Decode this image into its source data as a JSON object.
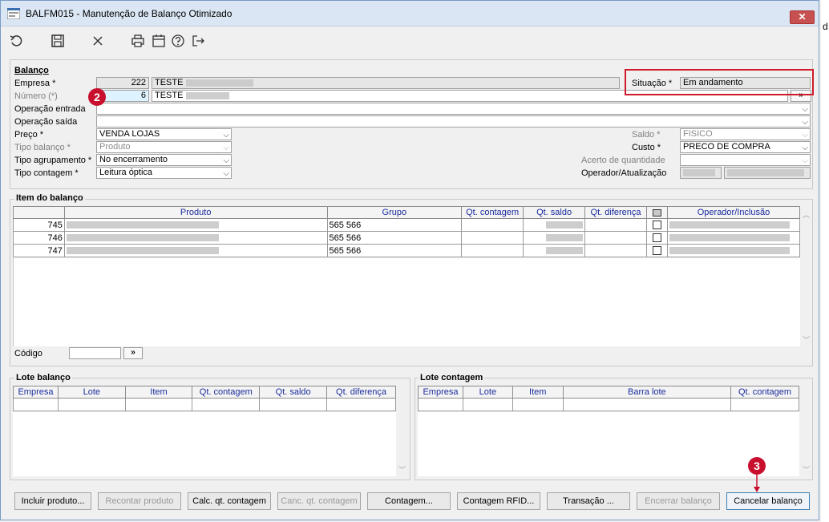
{
  "window": {
    "title": "BALFM015 - Manutenção de Balanço Otimizado",
    "close_label": "✕"
  },
  "edge_text": "d",
  "toolbar": {
    "buttons": [
      {
        "icon": "undo-icon"
      },
      {
        "icon": "save-icon"
      },
      {
        "icon": "close-icon"
      },
      {
        "icon": "print-icon"
      },
      {
        "icon": "calendar-icon"
      },
      {
        "icon": "help-icon"
      },
      {
        "icon": "exit-icon"
      }
    ]
  },
  "balanco": {
    "section_title": "Balanço",
    "empresa": {
      "label": "Empresa *",
      "code": "222",
      "name": "TESTE"
    },
    "numero": {
      "label": "Número (*)",
      "value": "6",
      "name": "TESTE",
      "button": "»"
    },
    "operacao_entrada": {
      "label": "Operação entrada",
      "value": ""
    },
    "operacao_saida": {
      "label": "Operação saída",
      "value": ""
    },
    "preco": {
      "label": "Preço *",
      "value": "VENDA LOJAS"
    },
    "tipo_balanco": {
      "label": "Tipo balanço *",
      "value": "Produto"
    },
    "tipo_agrupamento": {
      "label": "Tipo agrupamento *",
      "value": "No encerramento"
    },
    "tipo_contagem": {
      "label": "Tipo contagem *",
      "value": "Leitura óptica"
    },
    "situacao": {
      "label": "Situação *",
      "value": "Em andamento"
    },
    "saldo": {
      "label": "Saldo *",
      "value": "FISICO"
    },
    "custo": {
      "label": "Custo *",
      "value": "PRECO DE COMPRA"
    },
    "acerto": {
      "label": "Acerto de quantidade",
      "value": ""
    },
    "operador": {
      "label": "Operador/Atualização"
    }
  },
  "item_balanco": {
    "section_title": "Item do balanço",
    "columns": [
      "Produto",
      "Grupo",
      "Qt. contagem",
      "Qt. saldo",
      "Qt. diferença",
      "",
      "Operador/Inclusão"
    ],
    "rows": [
      {
        "num": "745",
        "grupo": "565 566"
      },
      {
        "num": "746",
        "grupo": "565 566"
      },
      {
        "num": "747",
        "grupo": "565 566"
      }
    ],
    "codigo_label": "Código",
    "codigo_value": "",
    "codigo_button": "»"
  },
  "lote_balanco": {
    "section_title": "Lote balanço",
    "columns": [
      "Empresa",
      "Lote",
      "Item",
      "Qt. contagem",
      "Qt. saldo",
      "Qt. diferença"
    ]
  },
  "lote_contagem": {
    "section_title": "Lote contagem",
    "columns": [
      "Empresa",
      "Lote",
      "Item",
      "Barra lote",
      "Qt. contagem"
    ]
  },
  "footer_buttons": [
    {
      "label": "Incluir produto...",
      "enabled": true
    },
    {
      "label": "Recontar produto",
      "enabled": false
    },
    {
      "label": "Calc. qt. contagem",
      "enabled": true
    },
    {
      "label": "Canc. qt. contagem",
      "enabled": false
    },
    {
      "label": "Contagem...",
      "enabled": true
    },
    {
      "label": "Contagem RFID...",
      "enabled": true
    },
    {
      "label": "Transação ...",
      "enabled": true
    },
    {
      "label": "Encerrar balanço",
      "enabled": false
    },
    {
      "label": "Cancelar balanço",
      "enabled": true
    }
  ],
  "annotations": {
    "marker_2": "2",
    "marker_3": "3"
  },
  "colors": {
    "annotation_red": "#c8102e",
    "header_text": "#1a2c9c",
    "highlight_field": "#ddf3ff"
  }
}
